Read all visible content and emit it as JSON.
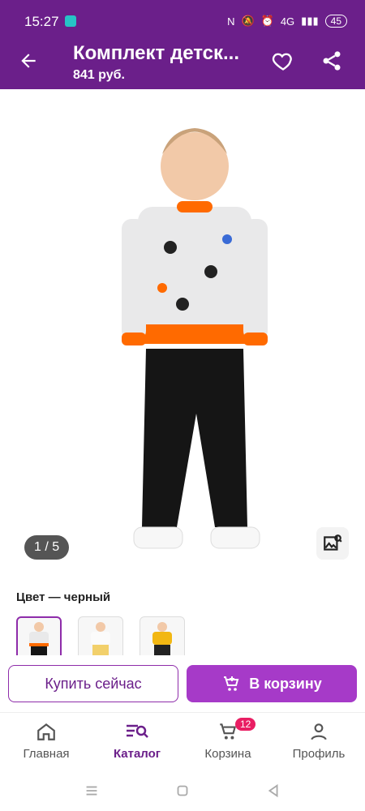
{
  "status_bar": {
    "time": "15:27",
    "signal_text": "4G",
    "battery": "45"
  },
  "app_bar": {
    "title": "Комплект детск...",
    "price": "841 руб."
  },
  "gallery": {
    "pager": "1 / 5"
  },
  "color": {
    "label": "Цвет — черный",
    "swatches": [
      {
        "name": "черный",
        "selected": true
      },
      {
        "name": "белый",
        "selected": false
      },
      {
        "name": "желтый",
        "selected": false
      }
    ]
  },
  "actions": {
    "buy_now": "Купить сейчас",
    "add_to_cart": "В корзину"
  },
  "bottom_nav": {
    "items": [
      {
        "label": "Главная",
        "icon": "home-icon"
      },
      {
        "label": "Каталог",
        "icon": "catalog-search-icon"
      },
      {
        "label": "Корзина",
        "icon": "cart-icon",
        "badge": "12"
      },
      {
        "label": "Профиль",
        "icon": "profile-icon"
      }
    ],
    "active_index": 1
  },
  "colors": {
    "primary": "#6b1f8a",
    "accent": "#a63ac8",
    "badge": "#e91e63"
  }
}
